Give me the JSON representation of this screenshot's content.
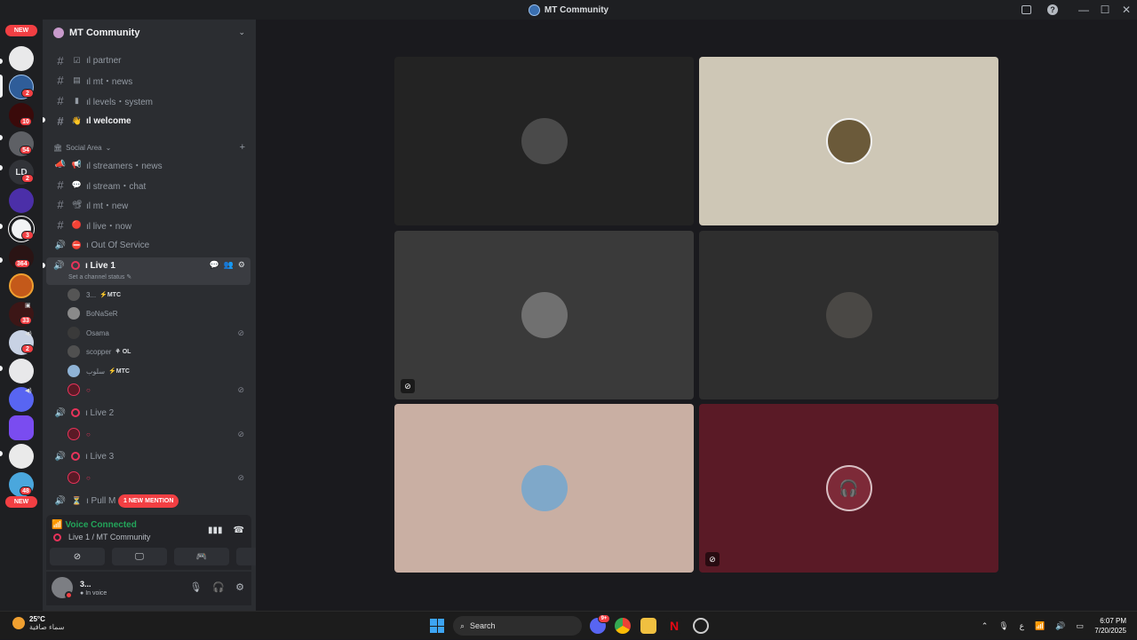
{
  "window": {
    "title": "MT Community"
  },
  "rail": {
    "new_top": "NEW",
    "new_bottom": "NEW",
    "badges": [
      "2",
      "10",
      "54",
      "2",
      "3",
      "364",
      "33",
      "2",
      "48"
    ],
    "ld_label": "LD"
  },
  "server": {
    "name": "MT Community"
  },
  "channels": [
    {
      "label": "ıl partner",
      "emoji": "☑"
    },
    {
      "label": "ıl mt・news",
      "emoji": "▤"
    },
    {
      "label": "ıl levels・system",
      "emoji": "▮"
    },
    {
      "label": "ıl welcome",
      "emoji": "👋"
    }
  ],
  "category": {
    "name": "Social Area"
  },
  "social_channels": [
    {
      "label": "ıl streamers・news",
      "emoji": "📢"
    },
    {
      "label": "ıl stream・chat",
      "emoji": "💬"
    },
    {
      "label": "ıl mt・new",
      "emoji": "📽"
    },
    {
      "label": "ıl live・now",
      "emoji": "🔴"
    },
    {
      "label": "ı Out Of Service",
      "emoji": "⛔"
    }
  ],
  "live1": {
    "label": "ı Live 1",
    "status": "Set a channel status"
  },
  "voice_users": [
    {
      "name": "3...",
      "tag": "⚡MTC"
    },
    {
      "name": "BoNaSeR",
      "tag": ""
    },
    {
      "name": "Osama",
      "tag": ""
    },
    {
      "name": "scopper",
      "tag": "⚘ OL"
    },
    {
      "name": "سلوب",
      "tag": "⚡MTC"
    },
    {
      "name": "○",
      "tag": ""
    }
  ],
  "live2": {
    "label": "ı Live 2",
    "user": "○"
  },
  "live3": {
    "label": "ı Live 3",
    "user": "○"
  },
  "pull": {
    "label": "ı Pull M",
    "mention": "1 NEW MENTION"
  },
  "voice": {
    "status": "Voice Connected",
    "channel": "Live 1 / MT Community"
  },
  "user": {
    "name": "3...",
    "sub": "In voice"
  },
  "taskbar": {
    "temp": "25°C",
    "desc": "سماء صافية",
    "search": "Search",
    "lang": "ع",
    "time": "6:07 PM",
    "date": "7/20/2025",
    "chat_badge": "9+"
  },
  "colors": {
    "accent": "#e8335a",
    "green": "#23a55a",
    "tile_beige": "#cec7b6",
    "tile_rose": "#c9afa3",
    "tile_maroon": "#5a1a26"
  }
}
